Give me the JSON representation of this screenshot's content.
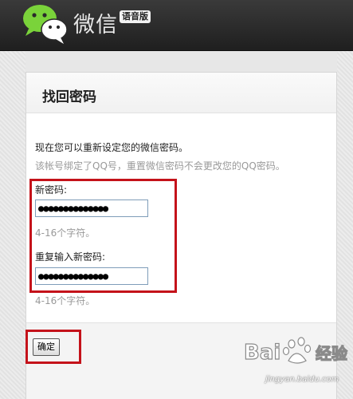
{
  "header": {
    "brand_name": "微信",
    "badge": "语音版",
    "logo_icon": "wechat-bubbles-icon",
    "colors": {
      "background": "#262626",
      "logo_green": "#7ad33a"
    }
  },
  "panel": {
    "title": "找回密码",
    "intro": "现在您可以重新设定您的微信密码。",
    "note": "该帐号绑定了QQ号，重置微信密码不会更改您的QQ密码。"
  },
  "form": {
    "new_password": {
      "label": "新密码:",
      "value": "●●●●●●●●●●●●●●",
      "hint": "4-16个字符。"
    },
    "repeat_password": {
      "label": "重复输入新密码:",
      "value": "●●●●●●●●●●●●●●",
      "hint": "4-16个字符。"
    },
    "confirm_label": "确定"
  },
  "annotation": {
    "highlight_color": "#c4121a"
  },
  "watermark": {
    "logo_text": "Bai度经验",
    "url": "jingyan.baidu.com"
  }
}
